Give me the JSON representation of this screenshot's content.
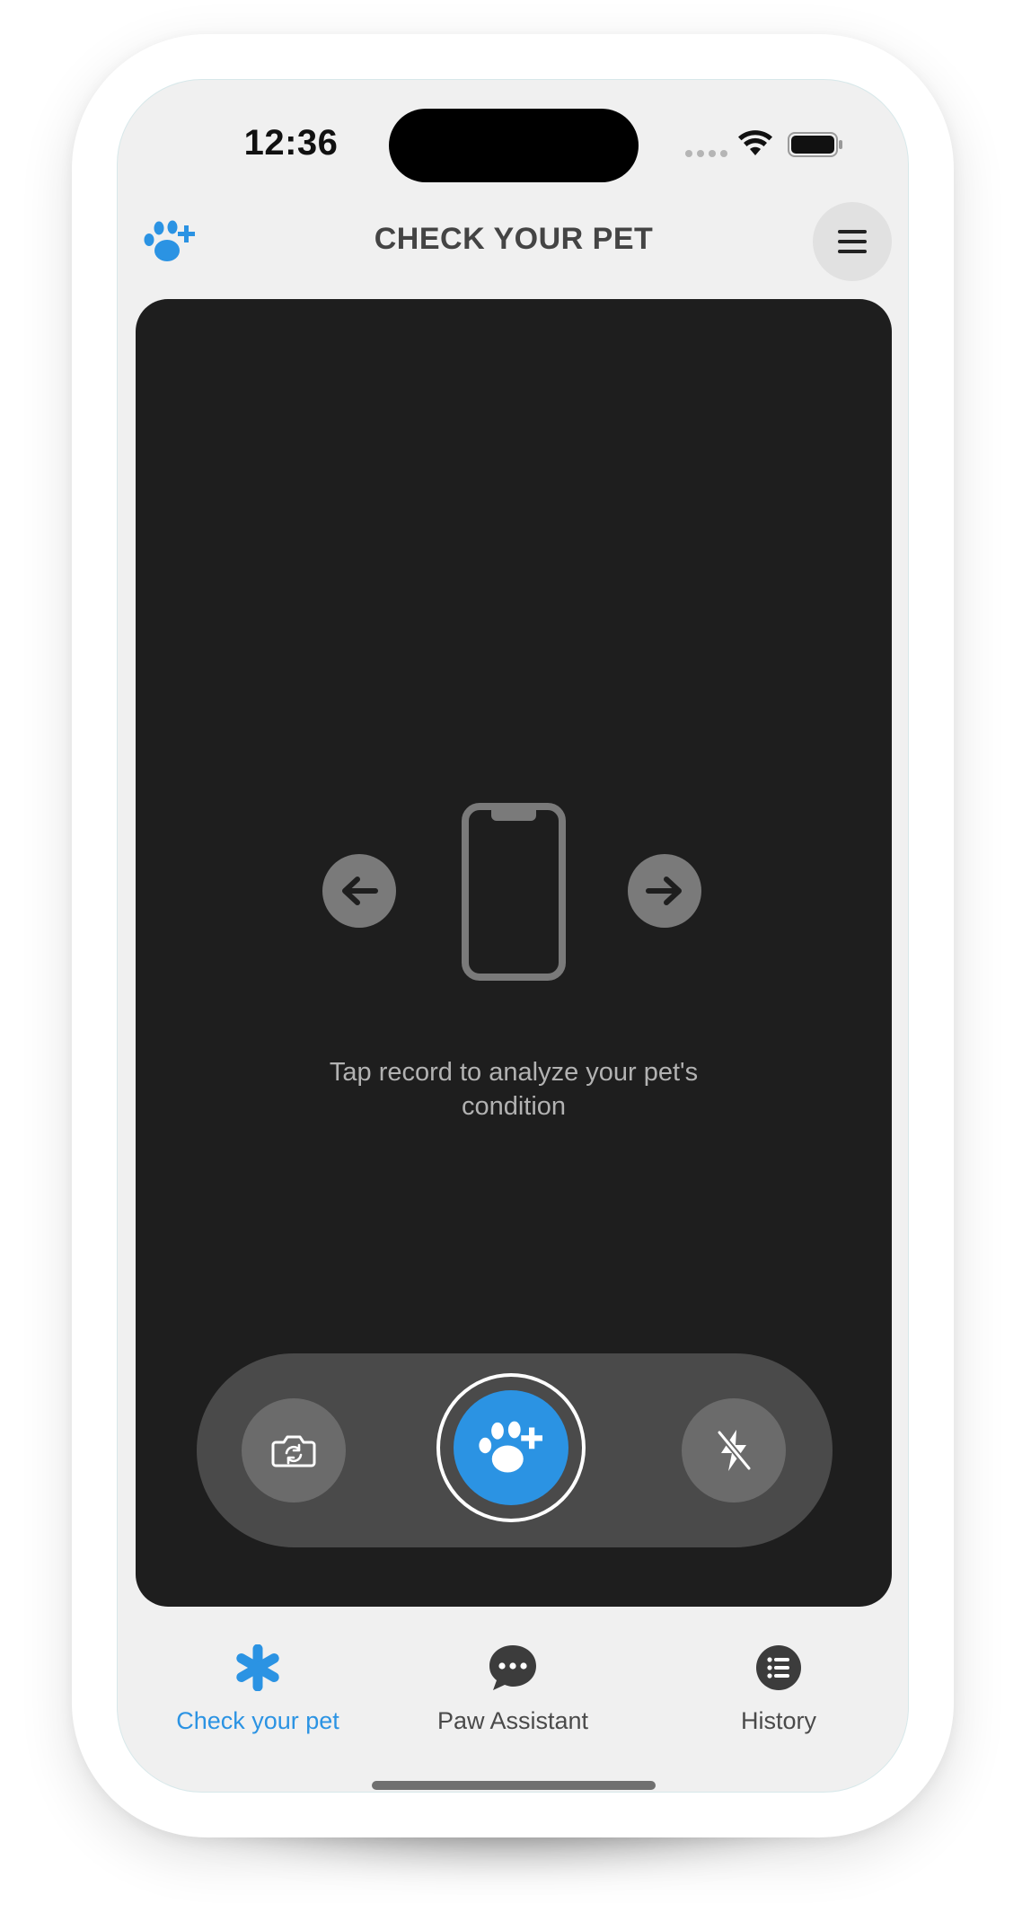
{
  "status_bar": {
    "time": "12:36"
  },
  "header": {
    "title": "CHECK YOUR PET",
    "logo_icon": "paw-plus-icon",
    "menu_icon": "hamburger-icon"
  },
  "camera": {
    "hint": "Tap record to analyze your pet's condition",
    "controls": {
      "flip_icon": "camera-flip-icon",
      "record_icon": "paw-plus-icon",
      "flash_icon": "flash-off-icon"
    }
  },
  "tabs": [
    {
      "label": "Check your pet",
      "icon": "asterisk-icon",
      "active": true
    },
    {
      "label": "Paw Assistant",
      "icon": "chat-bubble-icon",
      "active": false
    },
    {
      "label": "History",
      "icon": "list-icon",
      "active": false
    }
  ],
  "colors": {
    "accent": "#2b93e3",
    "panel": "#1e1e1e",
    "screen_bg": "#f0f0f0"
  }
}
